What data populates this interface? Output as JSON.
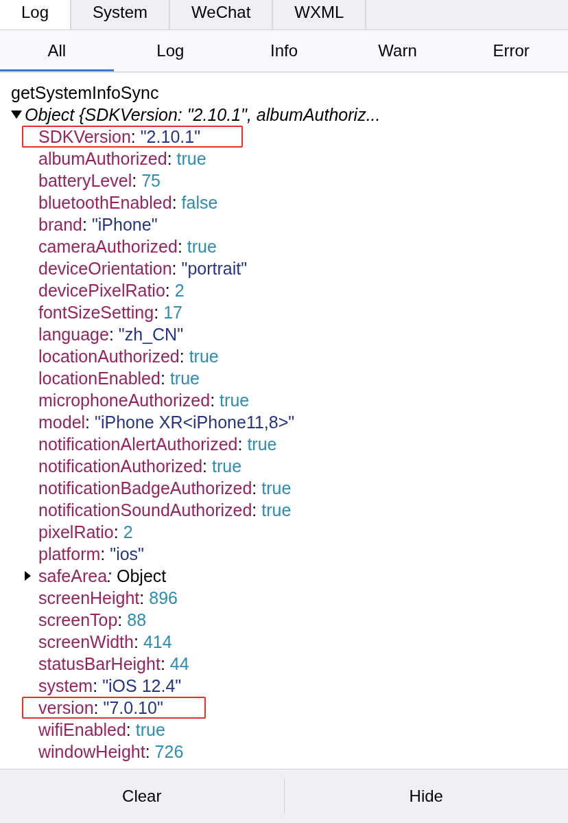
{
  "top_tabs": [
    {
      "label": "Log",
      "selected": true
    },
    {
      "label": "System",
      "selected": false
    },
    {
      "label": "WeChat",
      "selected": false
    },
    {
      "label": "WXML",
      "selected": false
    }
  ],
  "filter_tabs": [
    {
      "label": "All",
      "selected": true
    },
    {
      "label": "Log",
      "selected": false
    },
    {
      "label": "Info",
      "selected": false
    },
    {
      "label": "Warn",
      "selected": false
    },
    {
      "label": "Error",
      "selected": false
    }
  ],
  "console": {
    "message": "getSystemInfoSync",
    "object": {
      "summary": "Object {SDKVersion: \"2.10.1\", albumAuthoriz...",
      "expanded": true,
      "properties": [
        {
          "key": "SDKVersion",
          "separator": ":",
          "value": "\"2.10.1\"",
          "kind": "string",
          "highlighted": true
        },
        {
          "key": "albumAuthorized",
          "separator": ":",
          "value": "true",
          "kind": "boolean",
          "highlighted": false
        },
        {
          "key": "batteryLevel",
          "separator": ":",
          "value": "75",
          "kind": "number",
          "highlighted": false
        },
        {
          "key": "bluetoothEnabled",
          "separator": ":",
          "value": "false",
          "kind": "boolean",
          "highlighted": false
        },
        {
          "key": "brand",
          "separator": ":",
          "value": "\"iPhone\"",
          "kind": "string",
          "highlighted": false
        },
        {
          "key": "cameraAuthorized",
          "separator": ":",
          "value": "true",
          "kind": "boolean",
          "highlighted": false
        },
        {
          "key": "deviceOrientation",
          "separator": ":",
          "value": "\"portrait\"",
          "kind": "string",
          "highlighted": false
        },
        {
          "key": "devicePixelRatio",
          "separator": ":",
          "value": "2",
          "kind": "number",
          "highlighted": false
        },
        {
          "key": "fontSizeSetting",
          "separator": ":",
          "value": "17",
          "kind": "number",
          "highlighted": false
        },
        {
          "key": "language",
          "separator": ":",
          "value": "\"zh_CN\"",
          "kind": "string",
          "highlighted": false
        },
        {
          "key": "locationAuthorized",
          "separator": ":",
          "value": "true",
          "kind": "boolean",
          "highlighted": false
        },
        {
          "key": "locationEnabled",
          "separator": ":",
          "value": "true",
          "kind": "boolean",
          "highlighted": false
        },
        {
          "key": "microphoneAuthorized",
          "separator": ":",
          "value": "true",
          "kind": "boolean",
          "highlighted": false
        },
        {
          "key": "model",
          "separator": ":",
          "value": "\"iPhone XR<iPhone11,8>\"",
          "kind": "string",
          "highlighted": false
        },
        {
          "key": "notificationAlertAuthorized",
          "separator": ":",
          "value": "true",
          "kind": "boolean",
          "highlighted": false
        },
        {
          "key": "notificationAuthorized",
          "separator": ":",
          "value": "true",
          "kind": "boolean",
          "highlighted": false
        },
        {
          "key": "notificationBadgeAuthorized",
          "separator": ":",
          "value": "true",
          "kind": "boolean",
          "highlighted": false
        },
        {
          "key": "notificationSoundAuthorized",
          "separator": ":",
          "value": "true",
          "kind": "boolean",
          "highlighted": false
        },
        {
          "key": "pixelRatio",
          "separator": ":",
          "value": "2",
          "kind": "number",
          "highlighted": false
        },
        {
          "key": "platform",
          "separator": ":",
          "value": "\"ios\"",
          "kind": "string",
          "highlighted": false
        },
        {
          "key": "safeArea",
          "separator": ":",
          "value": "Object",
          "kind": "object",
          "expanded": false,
          "highlighted": false
        },
        {
          "key": "screenHeight",
          "separator": ":",
          "value": "896",
          "kind": "number",
          "highlighted": false
        },
        {
          "key": "screenTop",
          "separator": ":",
          "value": "88",
          "kind": "number",
          "highlighted": false
        },
        {
          "key": "screenWidth",
          "separator": ":",
          "value": "414",
          "kind": "number",
          "highlighted": false
        },
        {
          "key": "statusBarHeight",
          "separator": ":",
          "value": "44",
          "kind": "number",
          "highlighted": false
        },
        {
          "key": "system",
          "separator": ":",
          "value": "\"iOS 12.4\"",
          "kind": "string",
          "highlighted": false
        },
        {
          "key": "version",
          "separator": ":",
          "value": "\"7.0.10\"",
          "kind": "string",
          "highlighted": true
        },
        {
          "key": "wifiEnabled",
          "separator": ":",
          "value": "true",
          "kind": "boolean",
          "highlighted": false
        },
        {
          "key": "windowHeight",
          "separator": ":",
          "value": "726",
          "kind": "number",
          "highlighted": false
        }
      ]
    }
  },
  "buttons": [
    {
      "label": "Clear"
    },
    {
      "label": "Hide"
    }
  ]
}
